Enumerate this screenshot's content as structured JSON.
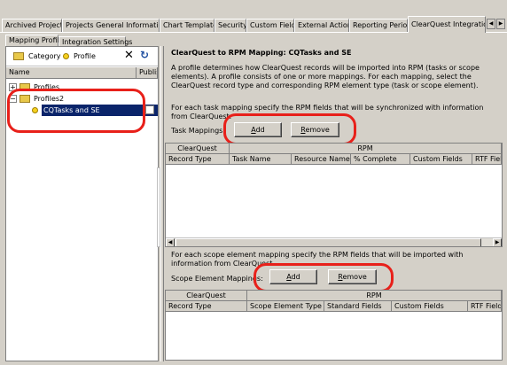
{
  "tabs": [
    {
      "label": "Archived Projects",
      "active": false
    },
    {
      "label": "Projects General Information",
      "active": false
    },
    {
      "label": "Chart Templates",
      "active": false
    },
    {
      "label": "Security",
      "active": false
    },
    {
      "label": "Custom Fields",
      "active": false
    },
    {
      "label": "External Actions",
      "active": false
    },
    {
      "label": "Reporting Periods",
      "active": false
    },
    {
      "label": "ClearQuest Integration",
      "active": true
    }
  ],
  "sub_tabs": [
    {
      "label": "Mapping Profile",
      "active": true
    },
    {
      "label": "Integration Settings",
      "active": false
    }
  ],
  "toolbar": {
    "category_label": "Category",
    "profile_label": "Profile"
  },
  "tree": {
    "col_name": "Name",
    "col_publish": "Publish",
    "items": [
      {
        "label": "Profiles"
      },
      {
        "label": "Profiles2"
      },
      {
        "label": "CQTasks and SE"
      }
    ]
  },
  "main": {
    "heading": "ClearQuest to RPM Mapping: CQTasks and SE",
    "description": "A profile determines how ClearQuest records will be imported into RPM (tasks or scope elements). A profile consists of one or more mappings. For each mapping, select the ClearQuest record type and corresponding RPM element type (task or scope element).",
    "task_intro": "For each task mapping specify the RPM fields that will be synchronized with information from ClearQuest.",
    "task_mappings_label": "Task Mappings:",
    "scope_intro": "For each scope element mapping specify the RPM fields that will be imported with information from ClearQuest.",
    "scope_mappings_label": "Scope Element Mappings:",
    "add_label": "Add",
    "remove_label": "Remove"
  },
  "task_grid": {
    "group_clearquest": "ClearQuest",
    "group_rpm": "RPM",
    "columns": [
      "Record Type",
      "Task Name",
      "Resource Name",
      "% Complete",
      "Custom Fields",
      "RTF Fields"
    ]
  },
  "scope_grid": {
    "group_clearquest": "ClearQuest",
    "group_rpm": "RPM",
    "columns": [
      "Record Type",
      "Scope Element Type",
      "Standard Fields",
      "Custom Fields",
      "RTF Fields"
    ]
  },
  "colors": {
    "highlight_oval": "#e8201a",
    "selection": "#0a246a",
    "chrome": "#d4d0c8"
  }
}
